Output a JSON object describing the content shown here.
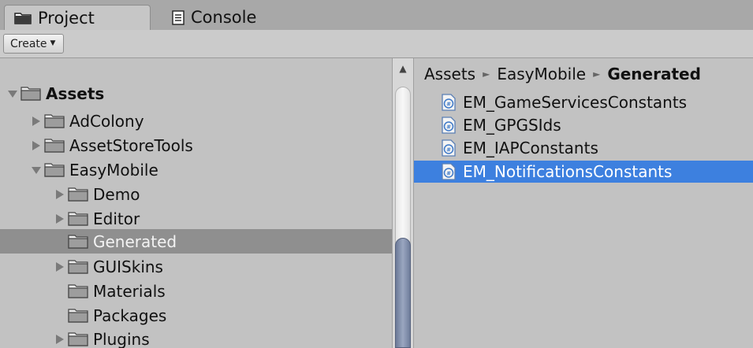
{
  "tabs": [
    {
      "label": "Project",
      "icon": "folder-icon",
      "active": true
    },
    {
      "label": "Console",
      "icon": "console-icon",
      "active": false
    }
  ],
  "toolbar": {
    "create_label": "Create",
    "create_caret": "▼"
  },
  "tree": {
    "items": [
      {
        "label": "Assets",
        "depth": 0,
        "expanded": true,
        "bold": true,
        "selected": false
      },
      {
        "label": "AdColony",
        "depth": 1,
        "expanded": false,
        "selected": false
      },
      {
        "label": "AssetStoreTools",
        "depth": 1,
        "expanded": false,
        "selected": false
      },
      {
        "label": "EasyMobile",
        "depth": 1,
        "expanded": true,
        "selected": false
      },
      {
        "label": "Demo",
        "depth": 2,
        "expanded": false,
        "selected": false
      },
      {
        "label": "Editor",
        "depth": 2,
        "expanded": false,
        "selected": false
      },
      {
        "label": "Generated",
        "depth": 2,
        "expanded": null,
        "selected": true
      },
      {
        "label": "GUISkins",
        "depth": 2,
        "expanded": false,
        "selected": false
      },
      {
        "label": "Materials",
        "depth": 2,
        "expanded": null,
        "selected": false
      },
      {
        "label": "Packages",
        "depth": 2,
        "expanded": null,
        "selected": false
      },
      {
        "label": "Plugins",
        "depth": 2,
        "expanded": false,
        "selected": false
      }
    ]
  },
  "breadcrumb": [
    "Assets",
    "EasyMobile",
    "Generated"
  ],
  "breadcrumb_separator": "►",
  "files": [
    {
      "name": "EM_GameServicesConstants",
      "icon": "csharp-script-icon",
      "selected": false
    },
    {
      "name": "EM_GPGSIds",
      "icon": "csharp-script-icon",
      "selected": false
    },
    {
      "name": "EM_IAPConstants",
      "icon": "csharp-script-icon",
      "selected": false
    },
    {
      "name": "EM_NotificationsConstants",
      "icon": "csharp-script-icon",
      "selected": true
    }
  ],
  "colors": {
    "selection": "#3d80df",
    "tree_selection": "#8f8f8f",
    "panel_bg": "#c2c2c2"
  }
}
